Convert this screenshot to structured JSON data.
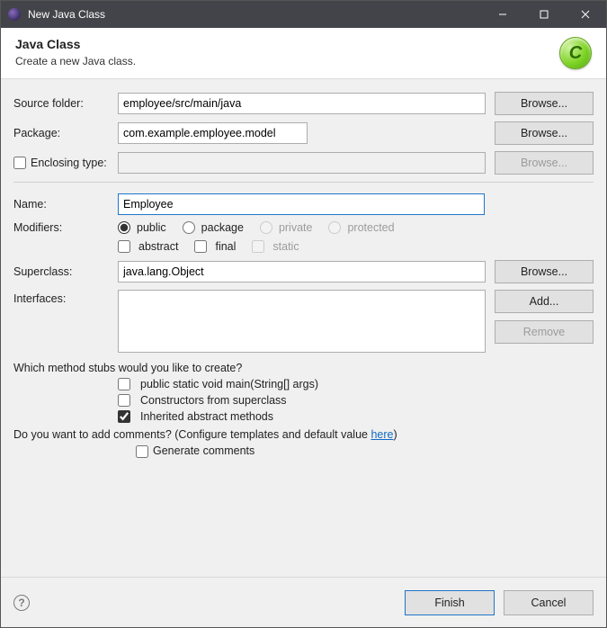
{
  "window": {
    "title": "New Java Class"
  },
  "header": {
    "title": "Java Class",
    "subtitle": "Create a new Java class.",
    "badge": "C"
  },
  "labels": {
    "source_folder": "Source folder:",
    "package": "Package:",
    "enclosing_type": "Enclosing type:",
    "name": "Name:",
    "modifiers": "Modifiers:",
    "superclass": "Superclass:",
    "interfaces": "Interfaces:"
  },
  "values": {
    "source_folder": "employee/src/main/java",
    "package": "com.example.employee.model",
    "enclosing_type": "",
    "name": "Employee",
    "superclass": "java.lang.Object"
  },
  "buttons": {
    "browse": "Browse...",
    "add": "Add...",
    "remove": "Remove",
    "finish": "Finish",
    "cancel": "Cancel"
  },
  "modifiers": {
    "visibility": {
      "public": "public",
      "package": "package",
      "private": "private",
      "protected": "protected"
    },
    "abstract": "abstract",
    "final": "final",
    "static": "static"
  },
  "stubs": {
    "question": "Which method stubs would you like to create?",
    "main": "public static void main(String[] args)",
    "constructors": "Constructors from superclass",
    "inherited": "Inherited abstract methods"
  },
  "comments": {
    "question_prefix": "Do you want to add comments? (Configure templates and default value ",
    "link": "here",
    "question_suffix": ")",
    "generate": "Generate comments"
  }
}
